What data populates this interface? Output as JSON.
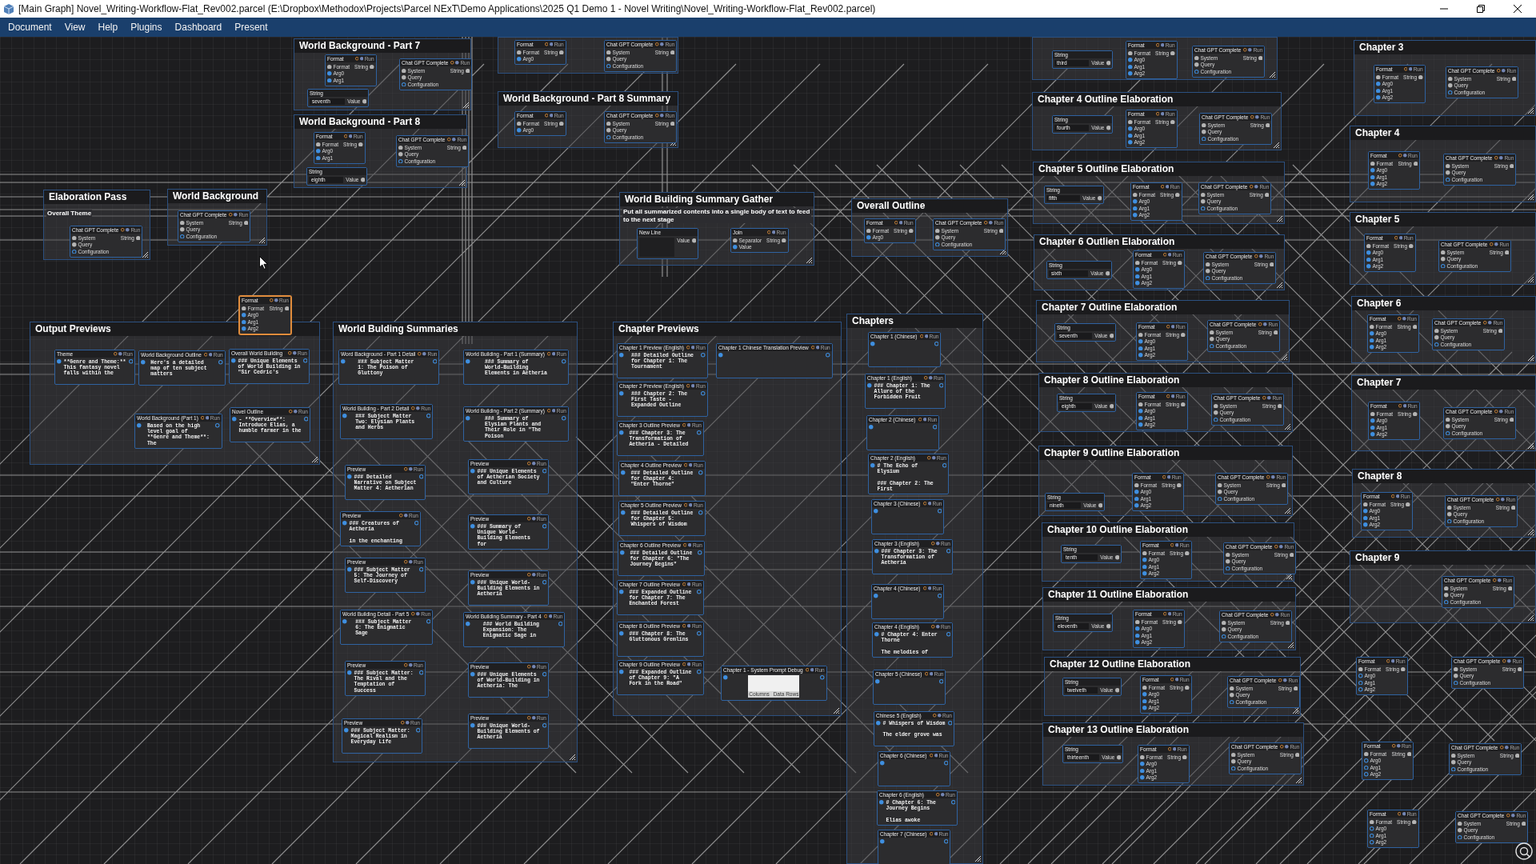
{
  "window": {
    "title": "[Main Graph] Novel_Writing-Workflow-Flat_Rev002.parcel (E:\\Dropbox\\Methodox\\Projects\\Parcel NExT\\Demo Applications\\2025 Q1 Demo 1 - Novel Writing\\Novel_Writing-Workflow-Flat_Rev002.parcel)"
  },
  "menu": [
    "Document",
    "View",
    "Help",
    "Plugins",
    "Dashboard",
    "Present"
  ],
  "groups": [
    {
      "title": "Elaboration Pass",
      "subtitle": "Overall Theme",
      "nodes": [
        {
          "kind": "chat",
          "title": "Chat GPT Complete",
          "run": "Run",
          "inputs": [
            "System",
            "Query",
            "Configuration"
          ],
          "output": "String",
          "selected": false
        }
      ]
    },
    {
      "title": "World Background",
      "nodes": [
        {
          "kind": "chat",
          "title": "Chat GPT Complete",
          "run": "Run",
          "inputs": [
            "System",
            "Query",
            "Configuration"
          ],
          "output": "String",
          "selected": false
        }
      ]
    },
    {
      "title": "World Background - Part 7",
      "nodes": [
        {
          "kind": "format",
          "title": "Format",
          "run": "Run",
          "inputs": [
            "Format",
            "Arg0",
            "Arg1"
          ],
          "output": "String",
          "args_linked": true,
          "selected": false
        },
        {
          "kind": "chat",
          "title": "Chat GPT Complete",
          "run": "Run",
          "inputs": [
            "System",
            "Query",
            "Configuration"
          ],
          "output": "String",
          "selected": false
        },
        {
          "kind": "string",
          "title": "String",
          "value": "seventh",
          "output": "Value",
          "selected": false
        }
      ]
    },
    {
      "title": "World Background - Part 8",
      "nodes": [
        {
          "kind": "format",
          "title": "Format",
          "run": "Run",
          "inputs": [
            "Format",
            "Arg0",
            "Arg1"
          ],
          "output": "String",
          "args_linked": true,
          "selected": false
        },
        {
          "kind": "chat",
          "title": "Chat GPT Complete",
          "run": "Run",
          "inputs": [
            "System",
            "Query",
            "Configuration"
          ],
          "output": "String",
          "selected": false
        },
        {
          "kind": "string",
          "title": "String",
          "value": "eighth",
          "output": "Value",
          "selected": false
        }
      ]
    },
    {
      "nodes": [
        {
          "kind": "format",
          "title": "Format",
          "run": "Run",
          "inputs": [
            "Format",
            "Arg0"
          ],
          "output": "String",
          "args_linked": true,
          "selected": false
        },
        {
          "kind": "chat",
          "title": "Chat GPT Complete",
          "run": "Run",
          "inputs": [
            "System",
            "Query",
            "Configuration"
          ],
          "output": "String",
          "selected": false
        }
      ]
    },
    {
      "title": "World Background - Part 8 Summary",
      "nodes": [
        {
          "kind": "format",
          "title": "Format",
          "run": "Run",
          "inputs": [
            "Format",
            "Arg0"
          ],
          "output": "String",
          "args_linked": true,
          "selected": false
        },
        {
          "kind": "chat",
          "title": "Chat GPT Complete",
          "run": "Run",
          "inputs": [
            "System",
            "Query",
            "Configuration"
          ],
          "output": "String",
          "selected": false
        }
      ]
    },
    {
      "title": "Output Previews",
      "nodes": [
        {
          "kind": "preview",
          "title": "Theme",
          "run": "Run",
          "text": "**Genre and Theme:** This fantasy novel falls within the",
          "selected": false
        },
        {
          "kind": "preview",
          "title": "World Background Outline",
          "run": "Run",
          "text": "Here's a detailed map of ten subject matters",
          "selected": false
        },
        {
          "kind": "preview",
          "title": "Overall World Building",
          "run": "Run",
          "text": "### Unique Elements of World Building in \"Sir Cedric's",
          "selected": false
        },
        {
          "kind": "preview",
          "title": "World Background (Part 1)",
          "run": "Run",
          "text": "Based on the high level goal of **Genre and Theme**: The",
          "selected": false
        },
        {
          "kind": "preview",
          "title": "Novel Outline",
          "run": "Run",
          "text": "- **Overview**: Introduce Elias, a humble farmer in the",
          "selected": false
        }
      ]
    },
    {
      "title": "World Bulding Summaries",
      "nodes": [
        {
          "kind": "preview",
          "title": "Word Background - Part 1 Detail",
          "run": "Run",
          "text": "### Subject Matter 1: The Poison of Gluttony",
          "selected": false
        },
        {
          "kind": "preview",
          "title": "World Building - Part 2 Detail",
          "run": "Run",
          "text": "### Subject Matter Two: Elysian Plants and Herbs",
          "selected": false
        },
        {
          "kind": "preview",
          "title": "Preview",
          "run": "Run",
          "text": "### Detailed Narrative on Subject Matter 4: Aetherian",
          "selected": false
        },
        {
          "kind": "preview",
          "title": "Preview",
          "run": "Run",
          "text": "### Creatures of Aetheria\n\nin the enchanting",
          "selected": false
        },
        {
          "kind": "preview",
          "title": "Preview",
          "run": "Run",
          "text": "### Subject Matter 5: The Journey of Self-Discovery",
          "selected": false
        },
        {
          "kind": "preview",
          "title": "World Building Detail - Part 5",
          "run": "Run",
          "text": "### Subject Matter 6: The Enigmatic Sage",
          "selected": false
        },
        {
          "kind": "preview",
          "title": "Preview",
          "run": "Run",
          "text": "### Subject Matter: The Rival and the Temptation of Success",
          "selected": false
        },
        {
          "kind": "preview",
          "title": "Preview",
          "run": "Run",
          "text": "### Subject Matter: Magical Realism in Everyday Life",
          "selected": false
        },
        {
          "kind": "preview",
          "title": "World Building - Part 1 (Summary)",
          "run": "Run",
          "text": "### Summary of World-Building Elements in Aetheria",
          "selected": false
        },
        {
          "kind": "preview",
          "title": "World Building - Part 2 (Summary)",
          "run": "Run",
          "text": "### Summary of Elysian Plants and Their Role in \"The Poison",
          "selected": false
        },
        {
          "kind": "preview",
          "title": "Preview",
          "run": "Run",
          "text": "### Unique Elements of Aetherian Society and Culture",
          "selected": false
        },
        {
          "kind": "preview",
          "title": "Preview",
          "run": "Run",
          "text": "### Summary of Unique World-Building Elements for",
          "selected": false
        },
        {
          "kind": "preview",
          "title": "Preview",
          "run": "Run",
          "text": "### Unique World-Building Elements in Aetheria",
          "selected": false
        },
        {
          "kind": "preview",
          "title": "World Building Summary - Part 4",
          "run": "Run",
          "text": "### World Building Expansion: The Enigmatic Sage in",
          "selected": false
        },
        {
          "kind": "preview",
          "title": "Preview",
          "run": "Run",
          "text": "### Unique Elements of World-Building in Aetheria: The",
          "selected": false
        },
        {
          "kind": "preview",
          "title": "Preview",
          "run": "Run",
          "text": "### Unique World-Building Elements of Aetheria",
          "selected": false
        }
      ]
    },
    {
      "title": "World Building Summary Gather",
      "subtitle": "Put all summarized contents into a single body of text to feed to the next stage",
      "nodes": [
        {
          "kind": "string",
          "title": "New Line",
          "output": "Value",
          "selected": false
        },
        {
          "kind": "join",
          "title": "Join",
          "run": "Run",
          "inputs": [
            "Separator",
            "Value"
          ],
          "output": "String",
          "selected": false
        }
      ]
    },
    {
      "title": "Chapter Previews",
      "nodes": [
        {
          "kind": "preview",
          "title": "Chapter 1 Preview (English)",
          "run": "Run",
          "text": "### Detailed Outline for Chapter 1: The Tournament",
          "selected": false
        },
        {
          "kind": "preview",
          "title": "Chapter 2 Preview (English)",
          "run": "Run",
          "text": "### Chapter 2: The First Taste - Expanded Outline",
          "selected": false
        },
        {
          "kind": "preview",
          "title": "Chapter 3 Outline Preview",
          "run": "Run",
          "text": "### Chapter 3: The Transformation of Aetheria - Detailed",
          "selected": false
        },
        {
          "kind": "preview",
          "title": "Chapter 4 Outline Preview",
          "run": "Run",
          "text": "### Detailed Outline for Chapter 4: \"Enter Thorne\"",
          "selected": false
        },
        {
          "kind": "preview",
          "title": "Chapter 5 Outline Preview",
          "run": "Run",
          "text": "### Detailed Outline for Chapter 5: Whispers of Wisdom",
          "selected": false
        },
        {
          "kind": "preview",
          "title": "Chapter 6 Outline Preview",
          "run": "Run",
          "text": "### Detailed Outline for Chapter 6: \"The Journey Begins\"",
          "selected": false
        },
        {
          "kind": "preview",
          "title": "Chapter 7 Outline Preview",
          "run": "Run",
          "text": "### Expanded Outline for Chapter 7: The Enchanted Forest",
          "selected": false
        },
        {
          "kind": "preview",
          "title": "Chapter 8 Outline Preview",
          "run": "Run",
          "text": "### Chapter 8: The Gluttonous Gremlins",
          "selected": false
        },
        {
          "kind": "preview",
          "title": "Chapter 9 Outline Preview",
          "run": "Run",
          "text": "### Expanded Outline of Chapter 9: \"A Fork in the Road\"",
          "selected": false
        },
        {
          "kind": "preview",
          "title": "Chapter 1 Chinese Translation Preview",
          "run": "Run",
          "selected": false
        },
        {
          "kind": "table",
          "title": "Chapter 1 - System Prompt Debug",
          "run": "Run",
          "footer": [
            "Columns",
            "Data Rows"
          ],
          "selected": false
        }
      ]
    },
    {
      "title": "Overall Outline",
      "nodes": [
        {
          "kind": "format",
          "title": "Format",
          "run": "Run",
          "inputs": [
            "Format",
            "Arg0"
          ],
          "output": "String",
          "args_linked": true,
          "selected": false
        },
        {
          "kind": "chat",
          "title": "Chat GPT Complete",
          "run": "Run",
          "inputs": [
            "System",
            "Query",
            "Configuration"
          ],
          "output": "String",
          "selected": false
        }
      ]
    },
    {
      "title": "Chapters",
      "nodes": [
        {
          "kind": "preview",
          "title": "Chapter 1 (Chinese)",
          "run": "Run",
          "selected": false
        },
        {
          "kind": "preview",
          "title": "Chapter 1 (English)",
          "run": "Run",
          "text": "### Chapter 1: The Allure of the Forbidden Fruit",
          "selected": false
        },
        {
          "kind": "preview",
          "title": "Chapter 2 (Chinese)",
          "run": "Run",
          "selected": false
        },
        {
          "kind": "preview",
          "title": "Chapter 2 (English)",
          "run": "Run",
          "text": "# The Echo of Elysium\n\n### Chapter 2: The First",
          "selected": false
        },
        {
          "kind": "preview",
          "title": "Chapter 3 (Chinese)",
          "run": "Run",
          "selected": false
        },
        {
          "kind": "preview",
          "title": "Chapter 3 (English)",
          "run": "Run",
          "text": "### Chapter 3: The Transformation of Aetheria",
          "selected": false
        },
        {
          "kind": "preview",
          "title": "Chapter 4 (Chinese)",
          "run": "Run",
          "selected": false
        },
        {
          "kind": "preview",
          "title": "Chapter 4 (English)",
          "run": "Run",
          "text": "# Chapter 4: Enter Thorne\n\nThe melodies of",
          "selected": false
        },
        {
          "kind": "preview",
          "title": "Chapter 5 (Chinese)",
          "run": "Run",
          "selected": false
        },
        {
          "kind": "preview",
          "title": "Chinese 5 (English)",
          "run": "Run",
          "text": "# Whispers of Wisdom\n\nThe elder grove was",
          "selected": false
        },
        {
          "kind": "preview",
          "title": "Chapter 6 (Chinese)",
          "run": "Run",
          "selected": false
        },
        {
          "kind": "preview",
          "title": "Chapter 6 (English)",
          "run": "Run",
          "text": "# Chapter 6: The Journey Begins\n\nElias awoke",
          "selected": false
        },
        {
          "kind": "preview",
          "title": "Chapter 7 (Chinese)",
          "run": "Run",
          "selected": false
        }
      ]
    },
    {
      "nodes": [
        {
          "kind": "string",
          "title": "String",
          "value": "third",
          "output": "Value",
          "selected": false
        },
        {
          "kind": "format",
          "title": "Format",
          "run": "Run",
          "inputs": [
            "Format",
            "Arg0",
            "Arg1",
            "Arg2"
          ],
          "output": "String",
          "args_linked": true,
          "selected": false
        },
        {
          "kind": "chat",
          "title": "Chat GPT Complete",
          "run": "Run",
          "inputs": [
            "System",
            "Query",
            "Configuration"
          ],
          "output": "String",
          "selected": false
        }
      ]
    },
    {
      "title": "Chapter 4 Outline Elaboration",
      "nodes": [
        {
          "kind": "string",
          "title": "String",
          "value": "fourth",
          "output": "Value",
          "selected": false
        },
        {
          "kind": "format",
          "title": "Format",
          "run": "Run",
          "inputs": [
            "Format",
            "Arg0",
            "Arg1",
            "Arg2"
          ],
          "output": "String",
          "args_linked": true,
          "selected": false
        },
        {
          "kind": "chat",
          "title": "Chat GPT Complete",
          "run": "Run",
          "inputs": [
            "System",
            "Query",
            "Configuration"
          ],
          "output": "String",
          "selected": false
        }
      ]
    },
    {
      "title": "Chapter 5 Outline Elaboration",
      "nodes": [
        {
          "kind": "string",
          "title": "String",
          "value": "fifth",
          "output": "Value",
          "selected": false
        },
        {
          "kind": "format",
          "title": "Format",
          "run": "Run",
          "inputs": [
            "Format",
            "Arg0",
            "Arg1",
            "Arg2"
          ],
          "output": "String",
          "args_linked": true,
          "selected": false
        },
        {
          "kind": "chat",
          "title": "Chat GPT Complete",
          "run": "Run",
          "inputs": [
            "System",
            "Query",
            "Configuration"
          ],
          "output": "String",
          "selected": false
        }
      ]
    },
    {
      "title": "Chapter 6 Outlien Elaboration",
      "nodes": [
        {
          "kind": "string",
          "title": "String",
          "value": "sixth",
          "output": "Value",
          "selected": false
        },
        {
          "kind": "format",
          "title": "Format",
          "run": "Run",
          "inputs": [
            "Format",
            "Arg0",
            "Arg1",
            "Arg2"
          ],
          "output": "String",
          "args_linked": true,
          "selected": false
        },
        {
          "kind": "chat",
          "title": "Chat GPT Complete",
          "run": "Run",
          "inputs": [
            "System",
            "Query",
            "Configuration"
          ],
          "output": "String",
          "selected": false
        }
      ]
    },
    {
      "title": "Chapter 7 Outline Elaboration",
      "nodes": [
        {
          "kind": "string",
          "title": "String",
          "value": "seventh",
          "output": "Value",
          "selected": false
        },
        {
          "kind": "format",
          "title": "Format",
          "run": "Run",
          "inputs": [
            "Format",
            "Arg0",
            "Arg1",
            "Arg2"
          ],
          "output": "String",
          "args_linked": true,
          "selected": false
        },
        {
          "kind": "chat",
          "title": "Chat GPT Complete",
          "run": "Run",
          "inputs": [
            "System",
            "Query",
            "Configuration"
          ],
          "output": "String",
          "selected": false
        }
      ]
    },
    {
      "title": "Chapter 8 Outline Elaboration",
      "nodes": [
        {
          "kind": "string",
          "title": "String",
          "value": "eighth",
          "output": "Value",
          "selected": false
        },
        {
          "kind": "format",
          "title": "Format",
          "run": "Run",
          "inputs": [
            "Format",
            "Arg0",
            "Arg1",
            "Arg2"
          ],
          "output": "String",
          "args_linked": true,
          "selected": false
        },
        {
          "kind": "chat",
          "title": "Chat GPT Complete",
          "run": "Run",
          "inputs": [
            "System",
            "Query",
            "Configuration"
          ],
          "output": "String",
          "selected": false
        }
      ]
    },
    {
      "title": "Chapter 9 Outline Elaboration",
      "nodes": [
        {
          "kind": "string",
          "title": "String",
          "value": "nineth",
          "output": "Value",
          "selected": false
        },
        {
          "kind": "format",
          "title": "Format",
          "run": "Run",
          "inputs": [
            "Format",
            "Arg0",
            "Arg1",
            "Arg2"
          ],
          "output": "String",
          "args_linked": true,
          "selected": false
        },
        {
          "kind": "chat",
          "title": "Chat GPT Complete",
          "run": "Run",
          "inputs": [
            "System",
            "Query",
            "Configuration"
          ],
          "output": "String",
          "selected": false
        }
      ]
    },
    {
      "title": "Chapter 10 Outline Elaboration",
      "nodes": [
        {
          "kind": "string",
          "title": "String",
          "value": "tenth",
          "output": "Value",
          "selected": false
        },
        {
          "kind": "format",
          "title": "Format",
          "run": "Run",
          "inputs": [
            "Format",
            "Arg0",
            "Arg1",
            "Arg2"
          ],
          "output": "String",
          "args_linked": true,
          "selected": false
        },
        {
          "kind": "chat",
          "title": "Chat GPT Complete",
          "run": "Run",
          "inputs": [
            "System",
            "Query",
            "Configuration"
          ],
          "output": "String",
          "selected": false
        }
      ]
    },
    {
      "title": "Chapter 11 Outline Elaboration",
      "nodes": [
        {
          "kind": "string",
          "title": "String",
          "value": "eleventh",
          "output": "Value",
          "selected": false
        },
        {
          "kind": "format",
          "title": "Format",
          "run": "Run",
          "inputs": [
            "Format",
            "Arg0",
            "Arg1",
            "Arg2"
          ],
          "output": "String",
          "args_linked": true,
          "selected": false
        },
        {
          "kind": "chat",
          "title": "Chat GPT Complete",
          "run": "Run",
          "inputs": [
            "System",
            "Query",
            "Configuration"
          ],
          "output": "String",
          "selected": false
        }
      ]
    },
    {
      "title": "Chapter 12 Outline Elaboration",
      "nodes": [
        {
          "kind": "string",
          "title": "String",
          "value": "twelveth",
          "output": "Value",
          "selected": false
        },
        {
          "kind": "format",
          "title": "Format",
          "run": "Run",
          "inputs": [
            "Format",
            "Arg0",
            "Arg1",
            "Arg2"
          ],
          "output": "String",
          "args_linked": true,
          "selected": false
        },
        {
          "kind": "chat",
          "title": "Chat GPT Complete",
          "run": "Run",
          "inputs": [
            "System",
            "Query",
            "Configuration"
          ],
          "output": "String",
          "selected": false
        }
      ]
    },
    {
      "title": "Chapter 13 Outline Elaboration",
      "nodes": [
        {
          "kind": "string",
          "title": "String",
          "value": "thirteenth",
          "output": "Value",
          "selected": false
        },
        {
          "kind": "format",
          "title": "Format",
          "run": "Run",
          "inputs": [
            "Format",
            "Arg0",
            "Arg1",
            "Arg2"
          ],
          "output": "String",
          "args_linked": true,
          "selected": false
        },
        {
          "kind": "chat",
          "title": "Chat GPT Complete",
          "run": "Run",
          "inputs": [
            "System",
            "Query",
            "Configuration"
          ],
          "output": "String",
          "selected": false
        }
      ]
    },
    {
      "title": "Chapter 3",
      "nodes": [
        {
          "kind": "format",
          "title": "Format",
          "run": "Run",
          "inputs": [
            "Format",
            "Arg0",
            "Arg1",
            "Arg2"
          ],
          "output": "String",
          "args_linked": true,
          "selected": false
        },
        {
          "kind": "chat",
          "title": "Chat GPT Complete",
          "run": "Run",
          "inputs": [
            "System",
            "Query",
            "Configuration"
          ],
          "output": "String",
          "selected": false
        }
      ]
    },
    {
      "title": "Chapter 4",
      "nodes": [
        {
          "kind": "format",
          "title": "Format",
          "run": "Run",
          "inputs": [
            "Format",
            "Arg0",
            "Arg1",
            "Arg2"
          ],
          "output": "String",
          "args_linked": true,
          "selected": false
        },
        {
          "kind": "chat",
          "title": "Chat GPT Complete",
          "run": "Run",
          "inputs": [
            "System",
            "Query",
            "Configuration"
          ],
          "output": "String",
          "selected": false
        }
      ]
    },
    {
      "title": "Chapter 5",
      "nodes": [
        {
          "kind": "format",
          "title": "Format",
          "run": "Run",
          "inputs": [
            "Format",
            "Arg0",
            "Arg1",
            "Arg2"
          ],
          "output": "String",
          "args_linked": true,
          "selected": false
        },
        {
          "kind": "chat",
          "title": "Chat GPT Complete",
          "run": "Run",
          "inputs": [
            "System",
            "Query",
            "Configuration"
          ],
          "output": "String",
          "selected": false
        }
      ]
    },
    {
      "title": "Chapter 6",
      "nodes": [
        {
          "kind": "format",
          "title": "Format",
          "run": "Run",
          "inputs": [
            "Format",
            "Arg0",
            "Arg1",
            "Arg2"
          ],
          "output": "String",
          "args_linked": true,
          "selected": false
        },
        {
          "kind": "chat",
          "title": "Chat GPT Complete",
          "run": "Run",
          "inputs": [
            "System",
            "Query",
            "Configuration"
          ],
          "output": "String",
          "selected": false
        }
      ]
    },
    {
      "title": "Chapter 7",
      "nodes": [
        {
          "kind": "format",
          "title": "Format",
          "run": "Run",
          "inputs": [
            "Format",
            "Arg0",
            "Arg1",
            "Arg2"
          ],
          "output": "String",
          "args_linked": true,
          "selected": false
        },
        {
          "kind": "chat",
          "title": "Chat GPT Complete",
          "run": "Run",
          "inputs": [
            "System",
            "Query",
            "Configuration"
          ],
          "output": "String",
          "selected": false
        }
      ]
    },
    {
      "title": "Chapter 8",
      "nodes": [
        {
          "kind": "format",
          "title": "Format",
          "run": "Run",
          "inputs": [
            "Format",
            "Arg0",
            "Arg1",
            "Arg2"
          ],
          "output": "String",
          "args_linked": true,
          "selected": false
        },
        {
          "kind": "chat",
          "title": "Chat GPT Complete",
          "run": "Run",
          "inputs": [
            "System",
            "Query",
            "Configuration"
          ],
          "output": "String",
          "selected": false
        }
      ]
    },
    {
      "title": "Chapter 9",
      "nodes": [
        {
          "kind": "chat",
          "title": "Chat GPT Complete",
          "run": "Run",
          "inputs": [
            "System",
            "Query",
            "Configuration"
          ],
          "output": "String",
          "selected": false
        }
      ]
    }
  ],
  "free_nodes": [
    {
      "kind": "format",
      "title": "Format",
      "run": "Run",
      "inputs": [
        "Format",
        "Arg0",
        "Arg1",
        "Arg2"
      ],
      "output": "String",
      "args_linked": true,
      "selected": true
    },
    {
      "kind": "format",
      "title": "Format",
      "run": "Run",
      "inputs": [
        "Format",
        "Arg0",
        "Arg1",
        "Arg2"
      ],
      "output": "String",
      "args_linked": false,
      "selected": false
    },
    {
      "kind": "chat",
      "title": "Chat GPT Complete",
      "run": "Run",
      "inputs": [
        "System",
        "Query",
        "Configuration"
      ],
      "output": "String",
      "selected": false
    },
    {
      "kind": "format",
      "title": "Format",
      "run": "Run",
      "inputs": [
        "Format",
        "Arg0",
        "Arg1",
        "Arg2"
      ],
      "output": "String",
      "args_linked": false,
      "selected": false
    },
    {
      "kind": "chat",
      "title": "Chat GPT Complete",
      "run": "Run",
      "inputs": [
        "System",
        "Query",
        "Configuration"
      ],
      "output": "String",
      "selected": false
    },
    {
      "kind": "format",
      "title": "Format",
      "run": "Run",
      "inputs": [
        "Format",
        "Arg0",
        "Arg1",
        "Arg2"
      ],
      "output": "String",
      "args_linked": false,
      "selected": false
    },
    {
      "kind": "chat",
      "title": "Chat GPT Complete",
      "run": "Run",
      "inputs": [
        "System",
        "Query",
        "Configuration"
      ],
      "output": "String",
      "selected": false
    }
  ]
}
